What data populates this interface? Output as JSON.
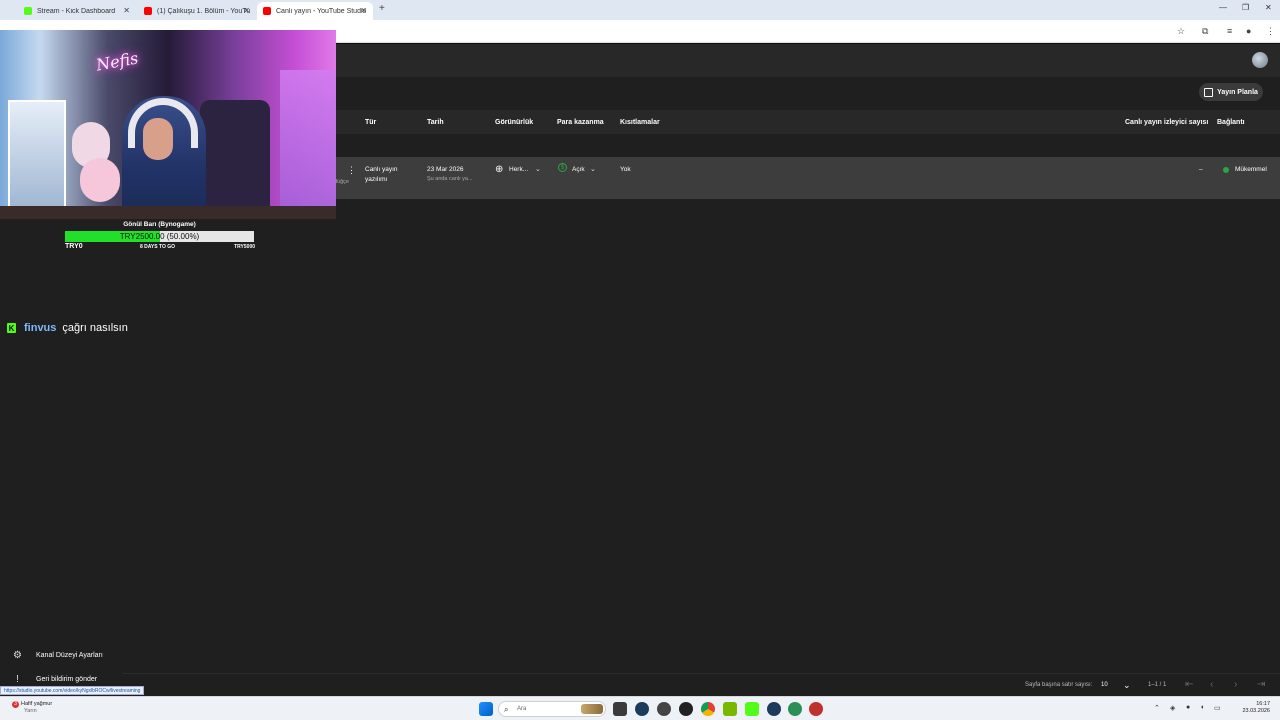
{
  "browser": {
    "tabs": [
      {
        "title": "Stream - Kick Dashboard",
        "favicon_color": "#53fc18",
        "active": false
      },
      {
        "title": "(1) Çalıkuşu 1. Bölüm - YouTube",
        "favicon_color": "#ff0000",
        "active": false
      },
      {
        "title": "Canlı yayın - YouTube Studio",
        "favicon_color": "#ff0000",
        "active": true
      }
    ],
    "new_tab_label": "+",
    "status_url": "https://studio.youtube.com/video/kyNgxlbROCw/livestreaming"
  },
  "studio": {
    "plan_button_label": "Yayın Planla",
    "columns": {
      "type": "Tür",
      "date": "Tarih",
      "visibility": "Görünürlük",
      "monetization": "Para kazanma",
      "restrictions": "Kısıtlamalar",
      "viewers": "Canlı yayın izleyici sayısı",
      "connection": "Bağlantı"
    },
    "row": {
      "title_fragment": "düğçe",
      "type_line1": "Canlı yayın",
      "type_line2": "yazılımı",
      "date": "23 Mar 2026",
      "date_sub": "Şu anda canlı ya...",
      "visibility": "Herk...",
      "monetization": "Açık",
      "restrictions": "Yok",
      "viewers": "–",
      "connection": "Mükemmel",
      "connection_color": "#2ba640",
      "monetization_color": "#2ba640"
    },
    "footer": {
      "rows_per_page_label": "Sayfa başına satır sayısı:",
      "rows_per_page_value": "10",
      "range": "1–1 / 1"
    },
    "sidebar": {
      "settings_label": "Kanal Düzeyi Ayarları",
      "feedback_label": "Geri bildirim gönder"
    }
  },
  "overlay": {
    "neon_sign": "Nefis",
    "donation": {
      "title": "Gönül Barı (Bynogame)",
      "bar_text": "TRY2500.00 (50.00%)",
      "progress": 0.5,
      "min_label": "TRY0",
      "days_label": "8 DAYS TO GO",
      "max_label": "TRY5000"
    },
    "chat": {
      "username": "finvus",
      "message": "çağrı nasılsın"
    }
  },
  "taskbar": {
    "weather_title": "Hafif yağmur",
    "weather_sub": "Yarın",
    "weather_badge": "3",
    "search_placeholder": "Ara",
    "time": "16:17",
    "date": "23.03.2026"
  }
}
